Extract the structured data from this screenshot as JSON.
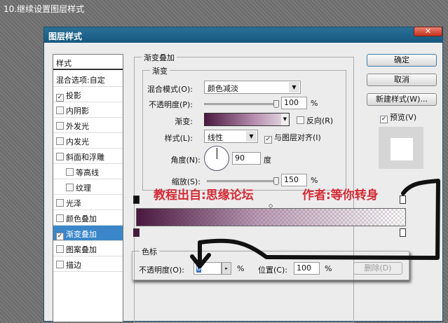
{
  "caption": "10.继续设置图层样式",
  "dialog": {
    "title": "图层样式",
    "close": "✕"
  },
  "list": {
    "header": "样式",
    "blend": "混合选项:自定",
    "items": [
      {
        "label": "投影",
        "checked": true
      },
      {
        "label": "内阴影",
        "checked": false
      },
      {
        "label": "外发光",
        "checked": false
      },
      {
        "label": "内发光",
        "checked": false
      },
      {
        "label": "斜面和浮雕",
        "checked": false
      },
      {
        "label": "等高线",
        "checked": false
      },
      {
        "label": "纹理",
        "checked": false
      },
      {
        "label": "光泽",
        "checked": false
      },
      {
        "label": "颜色叠加",
        "checked": false
      },
      {
        "label": "渐变叠加",
        "checked": true
      },
      {
        "label": "图案叠加",
        "checked": false
      },
      {
        "label": "描边",
        "checked": false
      }
    ]
  },
  "overlay": {
    "group": "渐变叠加",
    "sub": "渐变",
    "blend_label": "混合模式(O):",
    "blend_value": "颜色减淡",
    "opacity_label": "不透明度(P):",
    "opacity_value": "100",
    "pct": "%",
    "gradient_label": "渐变:",
    "reverse_label": "反向(R)",
    "style_label": "样式(L):",
    "style_value": "线性",
    "align_label": "与图层对齐(I)",
    "angle_label": "角度(N):",
    "angle_value": "90",
    "degree": "度",
    "scale_label": "缩放(S):",
    "scale_value": "150",
    "colors": {
      "dark": "#4a1840"
    }
  },
  "annotation": {
    "source": "教程出自:思缘论坛",
    "author": "作者:等你转身"
  },
  "stops": {
    "group": "色标",
    "opacity_label": "不透明度(O):",
    "opacity_value": "0",
    "pct": "%",
    "position_label": "位置(C):",
    "position_value": "100",
    "delete": "删除(D)"
  },
  "buttons": {
    "ok": "确定",
    "cancel": "取消",
    "new_style": "新建样式(W)...",
    "preview": "预览(V)"
  }
}
